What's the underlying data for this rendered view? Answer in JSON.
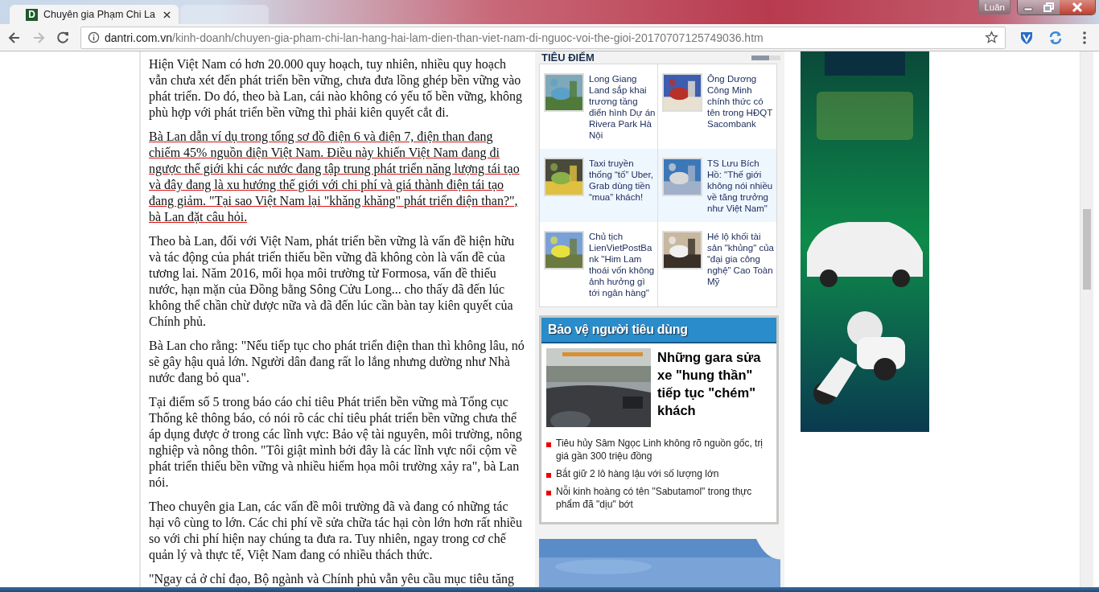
{
  "browser": {
    "tabs": [
      {
        "icon_text": "D",
        "title": "Chuyên gia Phạm Chi La",
        "selected": true
      },
      {
        "selected": false
      }
    ],
    "profile": "Luân",
    "address": {
      "domain": "dantri.com.vn",
      "path": "/kinh-doanh/chuyen-gia-pham-chi-lan-hang-hai-lam-dien-than-viet-nam-di-nguoc-voi-the-gioi-20170707125749036.htm",
      "bookmarked": false
    },
    "forward_disabled": true
  },
  "article": {
    "paragraphs": [
      {
        "text": "Hiện Việt Nam có hơn 20.000 quy hoạch, tuy nhiên, nhiều quy hoạch vẫn chưa xét đến phát triển bền vững, chưa đưa lồng ghép bền vững vào phát triển. Do đó, theo bà Lan, cái nào không có yếu tố bền vững, không phù hợp với phát triển bền vững thì phải kiên quyết cắt đi.",
        "underlined": false
      },
      {
        "text": "Bà Lan dẫn ví dụ trong tổng sơ đồ điện 6 và điện 7, điện than đang chiếm 45% nguồn điện Việt Nam. Điều này khiến Việt Nam đang đi ngược thế giới khi các nước đang tập trung phát triển năng lượng tái tạo và đây đang là xu hướng thế giới với chi phí và giá thành điện tái tạo đang giảm. \"Tại sao Việt Nam lại \"khăng khăng\" phát triển điện than?\", bà Lan đặt câu hỏi.",
        "underlined": true
      },
      {
        "text": "Theo bà Lan, đối với Việt Nam, phát triển bền vững là vấn đề hiện hữu và tác động của phát triển thiếu bền vững đã không còn là vấn đề của tương lai. Năm 2016, mối họa môi trường từ Formosa, vấn đề thiếu nước, hạn mặn của Đồng bằng Sông Cửu Long... cho thấy đã đến lúc không thể chần chừ được nữa và đã đến lúc cần bàn tay kiên quyết của Chính phủ.",
        "underlined": false
      },
      {
        "text": "Bà Lan cho rằng: \"Nếu tiếp tục cho phát triển điện than thì không lâu, nó sẽ gây hậu quả lớn. Người dân đang rất lo lắng nhưng dường như Nhà nước đang bỏ qua\".",
        "underlined": false
      },
      {
        "text": "Tại điểm số 5 trong báo cáo chỉ tiêu Phát triển bền vững mà Tổng cục Thống kê thông báo, có nói rõ các chỉ tiêu phát triển bền vững chưa thể áp dụng được ở trong các lĩnh vực: Bảo vệ tài nguyên, môi trường, nông nghiệp và nông thôn. \"Tôi giật mình bởi đây là các lĩnh vực nổi cộm về phát triển thiếu bền vững và nhiều hiểm họa môi trường xảy ra\", bà Lan nói.",
        "underlined": false
      },
      {
        "text": "Theo chuyên gia Lan, các vấn đề môi trường đã và đang có những tác hại vô cùng to lớn. Các chi phí về sửa chữa tác hại còn lớn hơn rất nhiều so với chi phí hiện nay chúng ta đưa ra. Tuy nhiên, ngay trong cơ chế quản lý và thực tế, Việt Nam đang có nhiều thách thức.",
        "underlined": false
      },
      {
        "text": "\"Ngay cả ở chỉ đạo, Bộ ngành và Chính phủ vẫn yêu cầu mục tiêu tăng",
        "underlined": false
      }
    ]
  },
  "sidebar": {
    "section_title": "TIÊU ĐIỂM",
    "rows": [
      {
        "highlighted": false,
        "items": [
          {
            "title": "Long Giang Land sắp khai trương tầng điển hình Dự án Rivera Park Hà Nội"
          },
          {
            "title": "Ông Dương Công Minh chính thức có tên trong HĐQT Sacombank"
          }
        ]
      },
      {
        "highlighted": true,
        "items": [
          {
            "title": "Taxi truyền thống “tố” Uber, Grab dùng tiền “mua” khách!"
          },
          {
            "title": "TS Lưu Bích Hồ: \"Thế giới không nói nhiều về tăng trưởng như Việt Nam\""
          }
        ]
      },
      {
        "highlighted": false,
        "items": [
          {
            "title": "Chủ tịch LienVietPostBank \"Him Lam thoái vốn không ảnh hưởng gì tới ngân hàng\""
          },
          {
            "title": "Hé lộ khối tài sản \"khủng\" của “đại gia công nghệ” Cao Toàn Mỹ"
          }
        ]
      }
    ],
    "consumer": {
      "title": "Bảo vệ người tiêu dùng",
      "headline": "Những gara sửa xe \"hung thần\" tiếp tục \"chém\" khách",
      "links": [
        "Tiêu hủy Sâm Ngọc Linh không rõ nguồn gốc, trị giá gần 300 triệu đồng",
        "Bắt giữ 2 lô hàng lậu với số lượng lớn",
        "Nỗi kinh hoàng có tên \"Sabutamol\" trong thực phẩm đã \"dịu\" bớt"
      ]
    }
  }
}
